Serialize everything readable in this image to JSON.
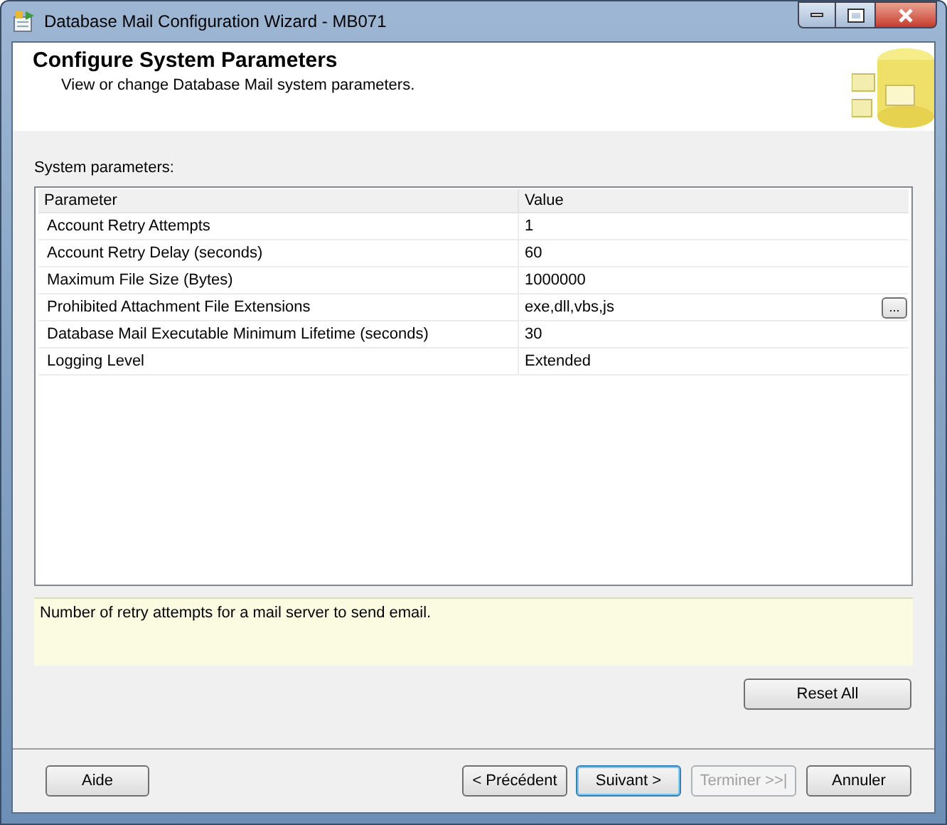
{
  "window": {
    "title": "Database Mail Configuration Wizard - MB071"
  },
  "header": {
    "title": "Configure System Parameters",
    "subtitle": "View or change Database Mail system parameters."
  },
  "grid": {
    "label": "System parameters:",
    "columns": [
      "Parameter",
      "Value"
    ],
    "rows": [
      {
        "parameter": "Account Retry Attempts",
        "value": "1"
      },
      {
        "parameter": "Account Retry Delay (seconds)",
        "value": "60"
      },
      {
        "parameter": "Maximum File Size (Bytes)",
        "value": "1000000"
      },
      {
        "parameter": "Prohibited Attachment File Extensions",
        "value": "exe,dll,vbs,js",
        "button": "..."
      },
      {
        "parameter": "Database Mail Executable Minimum Lifetime (seconds)",
        "value": "30"
      },
      {
        "parameter": "Logging Level",
        "value": "Extended"
      }
    ]
  },
  "description": "Number of retry attempts for a mail server to send email.",
  "reset_button": "Reset All",
  "buttons": [
    {
      "label": "Aide",
      "disabled": false,
      "default": false
    },
    {
      "label": "< Précédent",
      "disabled": false,
      "default": false
    },
    {
      "label": "Suivant >",
      "disabled": false,
      "default": true
    },
    {
      "label": "Terminer >>|",
      "disabled": true,
      "default": false
    },
    {
      "label": "Annuler",
      "disabled": false,
      "default": false
    }
  ]
}
